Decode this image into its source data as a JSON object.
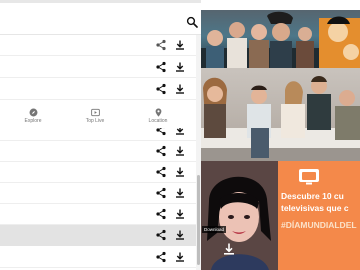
{
  "search": {
    "icon": "search-icon"
  },
  "nav": {
    "items": [
      {
        "label": "Explore",
        "icon": "compass-icon"
      },
      {
        "label": "Top Live",
        "icon": "play-icon"
      },
      {
        "label": "Location",
        "icon": "location-pin-icon"
      }
    ]
  },
  "list_rows": [
    {
      "actions": [
        "share-icon",
        "download-icon"
      ],
      "highlighted": false
    },
    {
      "actions": [
        "share-icon",
        "download-icon"
      ],
      "highlighted": false
    },
    {
      "actions": [
        "share-icon",
        "download-icon"
      ],
      "highlighted": false
    },
    {
      "actions": [
        "share-icon",
        "download-icon"
      ],
      "highlighted": false
    },
    {
      "actions": [
        "share-icon",
        "download-icon"
      ],
      "highlighted": false
    },
    {
      "actions": [
        "share-icon",
        "download-icon"
      ],
      "highlighted": false
    },
    {
      "actions": [
        "share-icon",
        "download-icon"
      ],
      "highlighted": false
    },
    {
      "actions": [
        "share-icon",
        "download-icon"
      ],
      "highlighted": false
    },
    {
      "actions": [
        "share-icon",
        "download-icon"
      ],
      "highlighted": false
    },
    {
      "actions": [
        "share-icon",
        "download-icon"
      ],
      "highlighted": true
    }
  ],
  "images": {
    "tile_3": {
      "promo_line_1": "Descubre 10 cu",
      "promo_line_2": "televisivas que c",
      "hashtag": "#DÍAMUNDIALDEL",
      "download_label": "Download"
    }
  },
  "colors": {
    "promo_orange": "#f4894a",
    "highlight_row": "#e3e3e3",
    "icon_dark": "#111111",
    "icon_share": "#555555"
  }
}
